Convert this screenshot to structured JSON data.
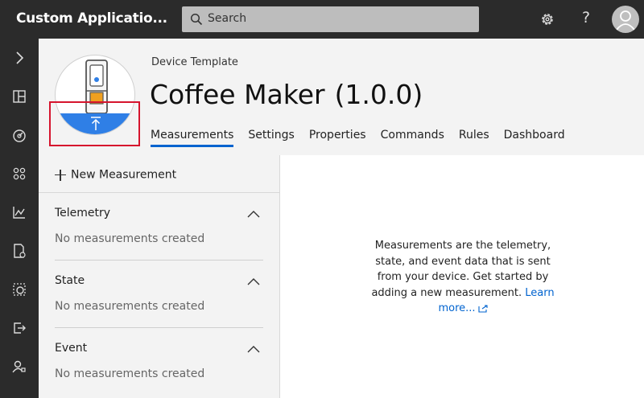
{
  "app": {
    "title": "Custom Applicatio..."
  },
  "search": {
    "placeholder": "Search"
  },
  "template": {
    "subtitle": "Device Template",
    "name": "Coffee Maker",
    "version": "(1.0.0)"
  },
  "tabs": [
    {
      "label": "Measurements",
      "active": true
    },
    {
      "label": "Settings"
    },
    {
      "label": "Properties"
    },
    {
      "label": "Commands"
    },
    {
      "label": "Rules"
    },
    {
      "label": "Dashboard"
    }
  ],
  "measurements": {
    "new_label": "New Measurement",
    "sections": [
      {
        "title": "Telemetry",
        "empty": "No measurements created"
      },
      {
        "title": "State",
        "empty": "No measurements created"
      },
      {
        "title": "Event",
        "empty": "No measurements created"
      }
    ],
    "info_text": "Measurements are the telemetry, state, and event data that is sent from your device. Get started by adding a new measurement.",
    "learn_more": "Learn more..."
  },
  "sidebar": {
    "items": [
      {
        "icon": "chevron-right-icon"
      },
      {
        "icon": "dashboard-icon"
      },
      {
        "icon": "devices-icon"
      },
      {
        "icon": "apps-icon"
      },
      {
        "icon": "analytics-icon"
      },
      {
        "icon": "device-template-icon"
      },
      {
        "icon": "device-explorer-icon"
      },
      {
        "icon": "export-icon"
      },
      {
        "icon": "administration-icon"
      }
    ]
  },
  "colors": {
    "topbar": "#2b2b2b",
    "accent": "#0063cf",
    "highlight": "#d6142d",
    "logo_blue": "#2f7fe6"
  }
}
